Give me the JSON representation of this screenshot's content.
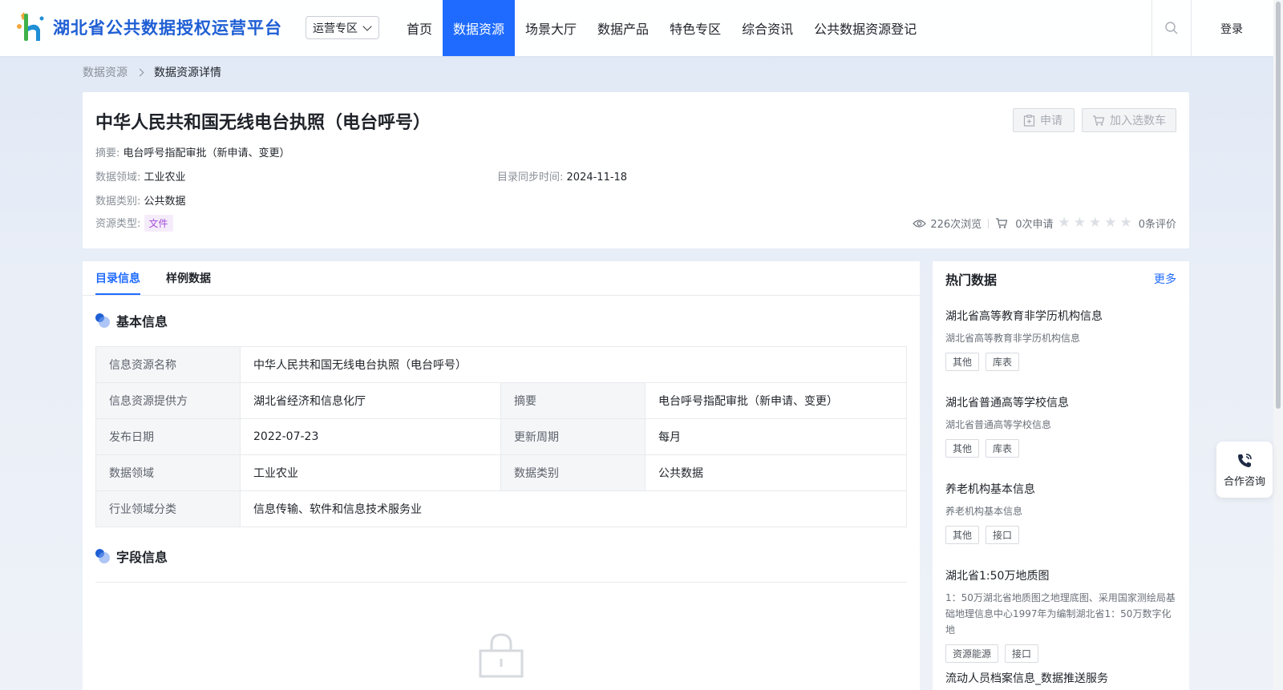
{
  "header": {
    "logo_text": "湖北省公共数据授权运营平台",
    "zone_select": "运营专区",
    "nav": [
      "首页",
      "数据资源",
      "场景大厅",
      "数据产品",
      "特色专区",
      "综合资讯",
      "公共数据资源登记"
    ],
    "active_nav": "数据资源",
    "login": "登录"
  },
  "breadcrumb": {
    "parent": "数据资源",
    "current": "数据资源详情"
  },
  "detail": {
    "title": "中华人民共和国无线电台执照（电台呼号）",
    "buttons": {
      "apply": "申请",
      "cart": "加入选数车"
    },
    "summary_label": "摘要:",
    "summary_value": "电台呼号指配审批（新申请、变更）",
    "domain_label": "数据领域:",
    "domain_value": "工业农业",
    "sync_label": "目录同步时间:",
    "sync_value": "2024-11-18",
    "category_label": "数据类别:",
    "category_value": "公共数据",
    "type_label": "资源类型:",
    "type_value": "文件",
    "views": "226次浏览",
    "applies": "0次申请",
    "rating": 0,
    "reviews": "0条评价"
  },
  "tabs": [
    "目录信息",
    "样例数据"
  ],
  "basic_info": {
    "title": "基本信息",
    "rows": [
      [
        {
          "k": "信息资源名称",
          "v": "中华人民共和国无线电台执照（电台呼号）"
        }
      ],
      [
        {
          "k": "信息资源提供方",
          "v": "湖北省经济和信息化厅"
        },
        {
          "k": "摘要",
          "v": "电台呼号指配审批（新申请、变更）"
        }
      ],
      [
        {
          "k": "发布日期",
          "v": "2022-07-23"
        },
        {
          "k": "更新周期",
          "v": "每月"
        }
      ],
      [
        {
          "k": "数据领域",
          "v": "工业农业"
        },
        {
          "k": "数据类别",
          "v": "公共数据"
        }
      ],
      [
        {
          "k": "行业领域分类",
          "v": "信息传输、软件和信息技术服务业"
        }
      ]
    ]
  },
  "field_info": {
    "title": "字段信息"
  },
  "hot": {
    "title": "热门数据",
    "more": "更多",
    "items": [
      {
        "name": "湖北省高等教育非学历机构信息",
        "desc": "湖北省高等教育非学历机构信息",
        "tags": [
          "其他",
          "库表"
        ]
      },
      {
        "name": "湖北省普通高等学校信息",
        "desc": "湖北省普通高等学校信息",
        "tags": [
          "其他",
          "库表"
        ]
      },
      {
        "name": "养老机构基本信息",
        "desc": "养老机构基本信息",
        "tags": [
          "其他",
          "接口"
        ]
      },
      {
        "name": "湖北省1:50万地质图",
        "desc": "1：50万湖北省地质图之地理底图、采用国家测绘局基础地理信息中心1997年为编制湖北省1：50万数字化地",
        "tags": [
          "资源能源",
          "接口"
        ]
      },
      {
        "name": "流动人员档案信息_数据推送服务",
        "desc": "",
        "tags": []
      }
    ]
  },
  "consult": {
    "label": "合作咨询"
  },
  "colors": {
    "primary": "#1f6bff",
    "brand": "#1f5fd4",
    "tag_file": "#a24ed8"
  }
}
